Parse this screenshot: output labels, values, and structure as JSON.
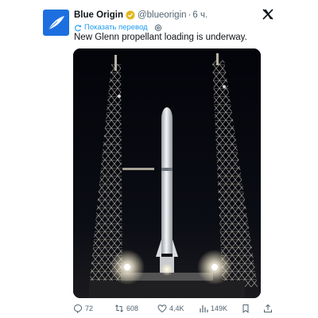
{
  "author": {
    "name": "Blue Origin",
    "handle": "@blueorigin",
    "separator": "·",
    "time": "6 ч."
  },
  "translate_label": "Показать перевод",
  "tweet_text": "New Glenn propellant loading is underway.",
  "actions": {
    "replies": "72",
    "reposts": "608",
    "likes": "4,4K",
    "views": "149K"
  },
  "colors": {
    "link": "#1d9bf0",
    "muted": "#536471",
    "avatar_bg": "#1d6fe0",
    "verified": "#e2b719"
  },
  "icons": [
    "feather-logo-icon",
    "verified-badge-icon",
    "x-logo-icon",
    "translate-icon",
    "settings-icon",
    "reply-icon",
    "repost-icon",
    "like-icon",
    "views-icon",
    "bookmark-icon",
    "share-icon"
  ]
}
